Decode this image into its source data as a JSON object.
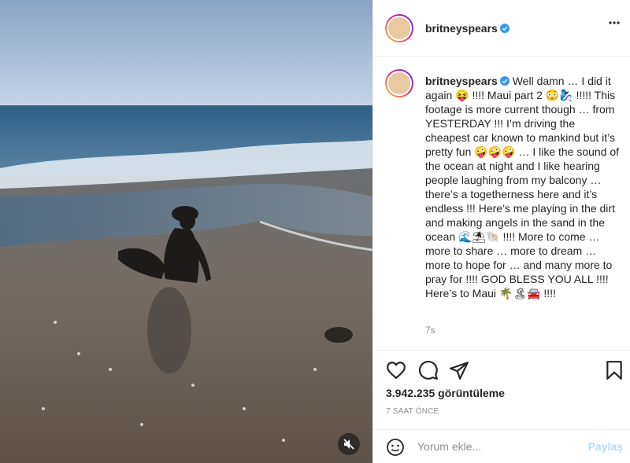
{
  "post": {
    "username": "britneyspears",
    "caption": " Well damn … I did it again 😝 !!!! Maui part 2 😳🧞‍♀️ !!!!! This footage is more current though … from YESTERDAY !!! I’m driving the cheapest car known to mankind but it’s pretty fun 🤪🤪🤪 … I like the sound of the ocean at night and I like hearing people laughing from my balcony … there’s a togetherness here and it’s endless !!! Here’s me playing in the dirt and making angels in the sand in the ocean 🌊⛱🐚 !!!! More to come … more to share … more to dream … more to hope for … and many more to pray for !!!! GOD BLESS YOU ALL !!!! Here’s to Maui 🌴🏝🚘 !!!!",
    "caption_age": "7s",
    "views": "3.942.235 görüntüleme",
    "posted": "7 SAAT ÖNCE"
  },
  "comment": {
    "placeholder": "Yorum ekle...",
    "post_label": "Paylaş"
  },
  "icons": {
    "verified": "verified-badge-icon",
    "more": "more-options-icon",
    "like": "heart-icon",
    "comment": "comment-icon",
    "share": "share-icon",
    "save": "bookmark-icon",
    "emoji": "emoji-icon",
    "mute": "mute-icon"
  },
  "colors": {
    "verified": "#3897f0",
    "post_button": "#b3dbff",
    "muted_text": "#8e8e8e"
  }
}
